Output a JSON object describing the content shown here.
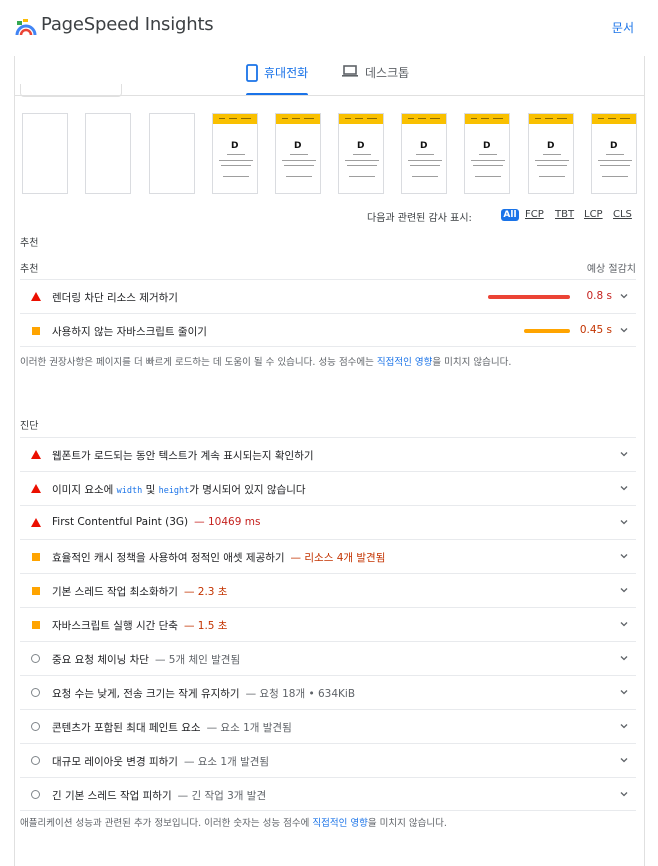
{
  "header": {
    "title": "PageSpeed Insights",
    "docs_link": "문서"
  },
  "tabs": [
    {
      "label": "휴대전화",
      "selected": true
    },
    {
      "label": "데스크톱",
      "selected": false
    }
  ],
  "filter": {
    "label": "다음과 관련된 감사 표시:",
    "options": [
      "All",
      "FCP",
      "TBT",
      "LCP",
      "CLS"
    ],
    "selected": "All"
  },
  "opportunities": {
    "heading": "추천",
    "column_left": "추천",
    "column_right": "예상 절감치",
    "items": [
      {
        "title": "렌더링 차단 리소스 제거하기",
        "savings": "0.8 s",
        "rating": "fail",
        "bar_fraction": 1.0
      },
      {
        "title": "사용하지 않는 자바스크립트 줄이기",
        "savings": "0.45 s",
        "rating": "average",
        "bar_fraction": 0.56
      }
    ],
    "footnote_before": "이러한 권장사항은 페이지를 더 빠르게 로드하는 데 도움이 될 수 있습니다. 성능 점수에는 ",
    "footnote_link": "직접적인 영향",
    "footnote_after": "을 미치지 않습니다."
  },
  "diagnostics": {
    "heading": "진단",
    "items": [
      {
        "title": "웹폰트가 로드되는 동안 텍스트가 계속 표시되는지 확인하기",
        "detail": "",
        "rating": "fail"
      },
      {
        "title_before": "이미지 요소에 ",
        "code1": "width",
        "title_mid": " 및 ",
        "code2": "height",
        "title_after": "가 명시되어 있지 않습니다",
        "rating": "fail"
      },
      {
        "title": "First Contentful Paint (3G)",
        "detail": "— 10469 ms",
        "rating": "fail"
      },
      {
        "title": "효율적인 캐시 정책을 사용하여 정적인 애셋 제공하기",
        "detail": "— 리소스 4개 발견됨",
        "rating": "average"
      },
      {
        "title": "기본 스레드 작업 최소화하기",
        "detail": "— 2.3 초",
        "rating": "average"
      },
      {
        "title": "자바스크립트 실행 시간 단축",
        "detail": "— 1.5 초",
        "rating": "average"
      },
      {
        "title": "중요 요청 체이닝 차단",
        "detail": "— 5개 체인 발견됨",
        "rating": "info"
      },
      {
        "title": "요청 수는 낮게, 전송 크기는 작게 유지하기",
        "detail": "— 요청 18개 • 634KiB",
        "rating": "info"
      },
      {
        "title": "콘텐츠가 포함된 최대 페인트 요소",
        "detail": "— 요소 1개 발견됨",
        "rating": "info"
      },
      {
        "title": "대규모 레이아웃 변경 피하기",
        "detail": "— 요소 1개 발견됨",
        "rating": "info"
      },
      {
        "title": "긴 기본 스레드 작업 피하기",
        "detail": "— 긴 작업 3개 발견",
        "rating": "info"
      }
    ],
    "footnote_before": "애플리케이션 성능과 관련된 추가 정보입니다. 이러한 숫자는 성능 점수에 ",
    "footnote_link": "직접적인 영향",
    "footnote_after": "을 미치지 않습니다."
  },
  "colors": {
    "fail": "#eb0f00",
    "average": "#ffa400",
    "info": "#80868b",
    "accent": "#1a73e8"
  }
}
